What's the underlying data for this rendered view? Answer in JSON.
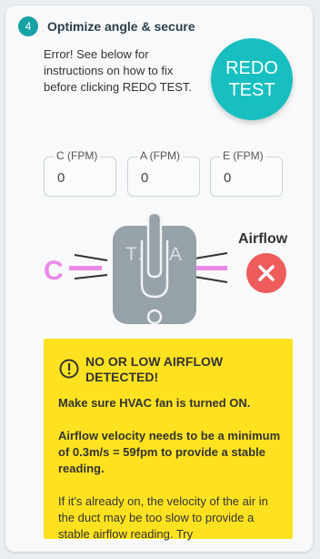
{
  "step": {
    "number": "4",
    "title": "Optimize angle & secure"
  },
  "error_message": "Error! See below for instructions on how to fix before clicking REDO TEST.",
  "redo_button": {
    "line1": "REDO",
    "line2": "TEST"
  },
  "readings": [
    {
      "label": "C (FPM)",
      "value": "0"
    },
    {
      "label": "A (FPM)",
      "value": "0"
    },
    {
      "label": "E (FPM)",
      "value": "0"
    }
  ],
  "diagram": {
    "c_label": "C",
    "device_text": "TZOA",
    "airflow_label": "Airflow",
    "status_icon": "x-circle-icon"
  },
  "alert": {
    "icon": "exclamation-circle-icon",
    "title": "NO OR LOW AIRFLOW DETECTED!",
    "line1": "Make sure HVAC fan is turned ON.",
    "line2": "Airflow velocity needs to be a minimum of 0.3m/s = 59fpm to provide a stable reading.",
    "line3": "If it's already on, the velocity of the air in the duct may be too slow to provide a stable airflow reading. Try"
  },
  "colors": {
    "accent": "#18bfc0",
    "error": "#ee5c5c",
    "alert_bg": "#ffe21f",
    "c_pink": "#e98ae6"
  }
}
